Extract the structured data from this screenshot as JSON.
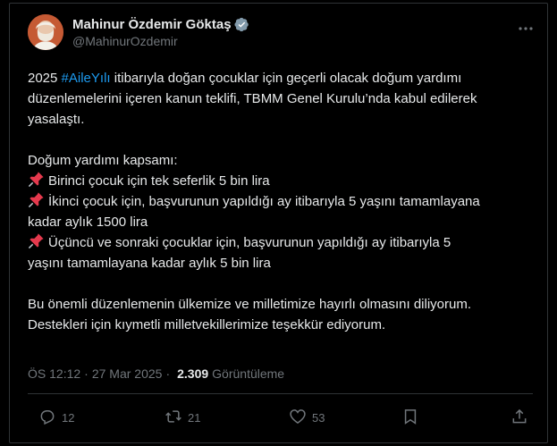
{
  "author": {
    "display_name": "Mahinur Özdemir Göktaş",
    "handle": "@MahinurOzdemir",
    "verified_color": "#829aab"
  },
  "tweet": {
    "line1_pre": "2025 ",
    "hashtag": "#AileYılı",
    "line1_post": " itibarıyla doğan çocuklar için geçerli olacak doğum yardımı",
    "line2": "düzenlemelerini içeren kanun teklifi, TBMM Genel Kurulu’nda kabul edilerek",
    "line3": "yasalaştı.",
    "line5": "Doğum yardımı kapsamı:",
    "bullet1": "Birinci çocuk için tek seferlik 5 bin lira",
    "bullet2a": "İkinci çocuk için, başvurunun yapıldığı ay itibarıyla 5 yaşını tamamlayana",
    "bullet2b": "kadar aylık 1500 lira",
    "bullet3a": "Üçüncü ve sonraki çocuklar için, başvurunun yapıldığı ay itibarıyla 5",
    "bullet3b": "yaşını tamamlayana kadar aylık 5 bin lira",
    "closing1": "Bu önemli düzenlemenin ülkemize ve milletimize hayırlı olmasını diliyorum.",
    "closing2": "Destekleri için kıymetli milletvekillerimize teşekkür ediyorum.",
    "pin_icon": "pushpin-icon"
  },
  "meta": {
    "time": "ÖS 12:12",
    "separator": "·",
    "date": "27 Mar 2025",
    "views_count": "2.309",
    "views_label": "Görüntüleme"
  },
  "actions": {
    "replies": "12",
    "reposts": "21",
    "likes": "53"
  },
  "colors": {
    "accent": "#1d9bf0",
    "muted": "#71767b",
    "text": "#e7e9ea",
    "border": "#2f3336"
  }
}
